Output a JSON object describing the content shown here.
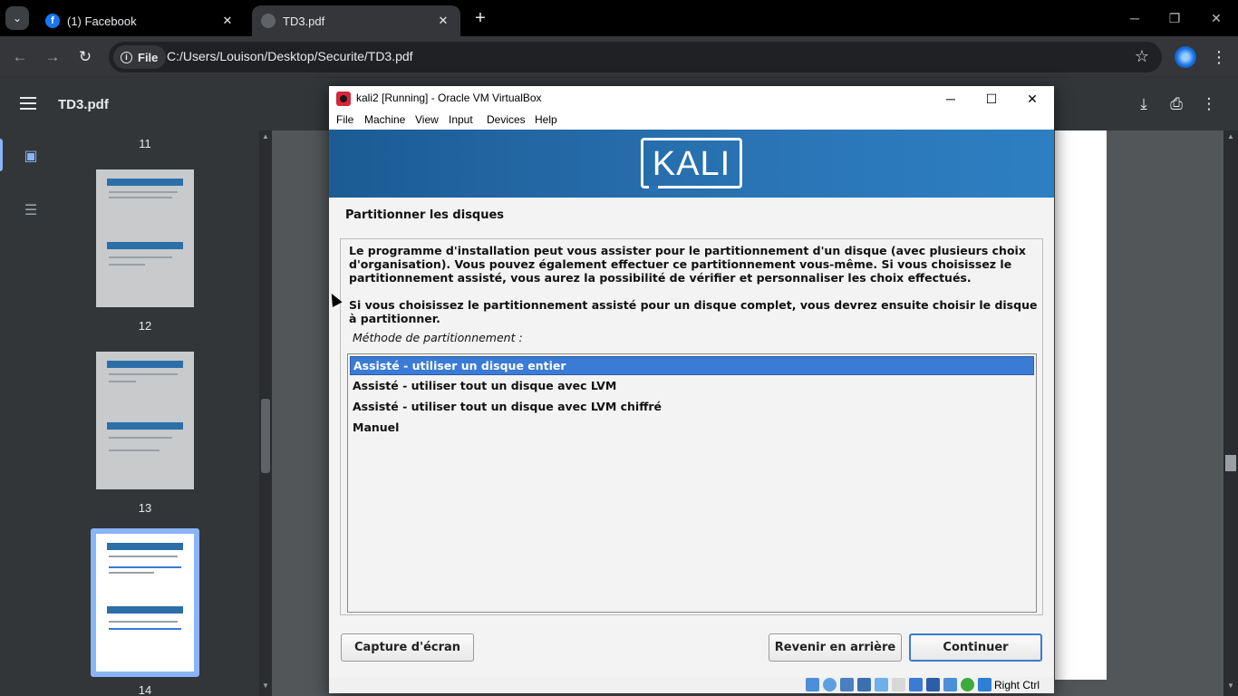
{
  "browser": {
    "tabs": [
      {
        "title": "(1) Facebook",
        "icon": "facebook-icon",
        "active": false
      },
      {
        "title": "TD3.pdf",
        "icon": "globe-icon",
        "active": true
      }
    ],
    "tab_search_glyph": "⌄",
    "new_tab_glyph": "+",
    "close_glyph": "✕",
    "window_controls": {
      "minimize": "─",
      "restore": "❐",
      "close": "✕"
    },
    "address": {
      "scheme_chip": "File",
      "url": "C:/Users/Louison/Desktop/Securite/TD3.pdf"
    },
    "nav": {
      "back": "←",
      "forward": "→",
      "reload": "↻"
    }
  },
  "pdf_viewer": {
    "title": "TD3.pdf",
    "thumbnails": [
      {
        "page": "11",
        "shown": "label-only"
      },
      {
        "page": "12",
        "style": "grey"
      },
      {
        "page": "13",
        "style": "grey"
      },
      {
        "page": "14",
        "style": "white",
        "selected": true
      }
    ],
    "colors": {
      "accent": "#8ab4f8",
      "toolbar": "#323639",
      "canvas": "#525659"
    }
  },
  "virtualbox": {
    "window_title": "kali2 [Running] - Oracle VM VirtualBox",
    "menu": [
      "File",
      "Machine",
      "View",
      "Input",
      "Devices",
      "Help"
    ],
    "status_text": "Right Ctrl",
    "installer": {
      "logo_text": "KALI",
      "step_title": "Partitionner les disques",
      "paragraph_1": "Le programme d'installation peut vous assister pour le partitionnement d'un disque (avec plusieurs choix d'organisation). Vous pouvez également effectuer ce partitionnement vous-même. Si vous choisissez le partitionnement assisté, vous aurez la possibilité de vérifier et personnaliser les choix effectués.",
      "paragraph_2": "Si vous choisissez le partitionnement assisté pour un disque complet, vous devrez ensuite choisir le disque à partitionner.",
      "method_label": "Méthode de partitionnement :",
      "options": [
        "Assisté - utiliser un disque entier",
        "Assisté - utiliser tout un disque avec LVM",
        "Assisté - utiliser tout un disque avec LVM chiffré",
        "Manuel"
      ],
      "selected_option": "Assisté - utiliser un disque entier",
      "buttons": {
        "screenshot": "Capture d'écran",
        "back": "Revenir en arrière",
        "continue": "Continuer"
      },
      "colors": {
        "banner": "#2a74b5",
        "selection": "#3a7bd5"
      }
    }
  }
}
